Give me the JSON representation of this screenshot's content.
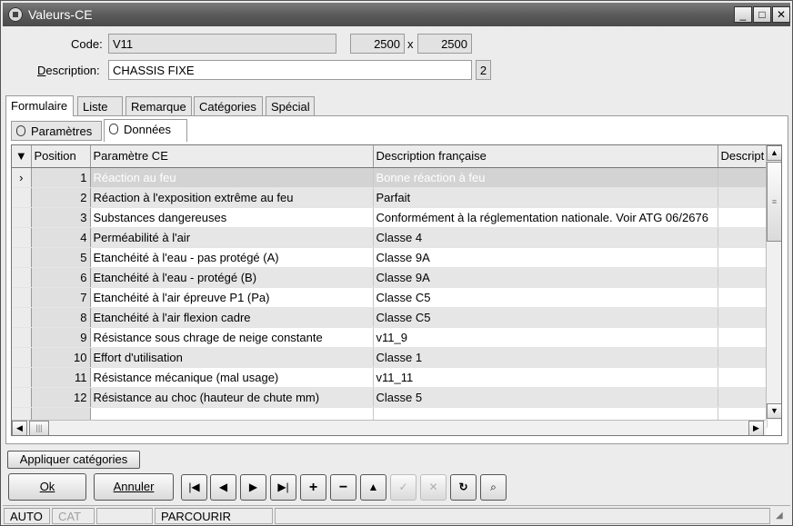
{
  "window": {
    "title": "Valeurs-CE",
    "controls": {
      "minimize": "_",
      "maximize": "□",
      "close": "✕"
    }
  },
  "form": {
    "code_label": "Code:",
    "code_value": "V11",
    "width_value": "2500",
    "dim_separator": "x",
    "height_value": "2500",
    "description_label": "Description:",
    "description_value": "CHASSIS FIXE",
    "description_count": "2"
  },
  "tabs": [
    "Formulaire",
    "Liste",
    "Remarque",
    "Catégories",
    "Spécial"
  ],
  "subtabs": [
    "Paramètres",
    "Données"
  ],
  "grid": {
    "columns": [
      "Position",
      "Paramètre CE",
      "Description française",
      "Descript"
    ],
    "rows": [
      {
        "pos": "1",
        "param": "Réaction au feu",
        "desc": "Bonne réaction à feu"
      },
      {
        "pos": "2",
        "param": "Réaction à l'exposition extrême au feu",
        "desc": "Parfait"
      },
      {
        "pos": "3",
        "param": "Substances dangereuses",
        "desc": "Conformément à la réglementation nationale. Voir ATG 06/2676"
      },
      {
        "pos": "4",
        "param": "Perméabilité à l'air",
        "desc": "Classe 4"
      },
      {
        "pos": "5",
        "param": "Etanchéité à l'eau - pas protégé (A)",
        "desc": "Classe 9A"
      },
      {
        "pos": "6",
        "param": "Etanchéité à l'eau - protégé (B)",
        "desc": "Classe 9A"
      },
      {
        "pos": "7",
        "param": "Etanchéité à l'air épreuve P1 (Pa)",
        "desc": "Classe C5"
      },
      {
        "pos": "8",
        "param": "Etanchéité à l'air flexion cadre",
        "desc": "Classe C5"
      },
      {
        "pos": "9",
        "param": "Résistance sous chrage de neige constante",
        "desc": "v11_9"
      },
      {
        "pos": "10",
        "param": "Effort d'utilisation",
        "desc": "Classe 1"
      },
      {
        "pos": "11",
        "param": "Résistance mécanique (mal usage)",
        "desc": "v11_11"
      },
      {
        "pos": "12",
        "param": "Résistance au choc (hauteur de chute mm)",
        "desc": "Classe 5"
      }
    ]
  },
  "buttons": {
    "apply_categories": "Appliquer catégories",
    "ok": "Ok",
    "cancel": "Annuler"
  },
  "status": {
    "mode": "AUTO",
    "cat": "CAT",
    "state": "PARCOURIR"
  }
}
